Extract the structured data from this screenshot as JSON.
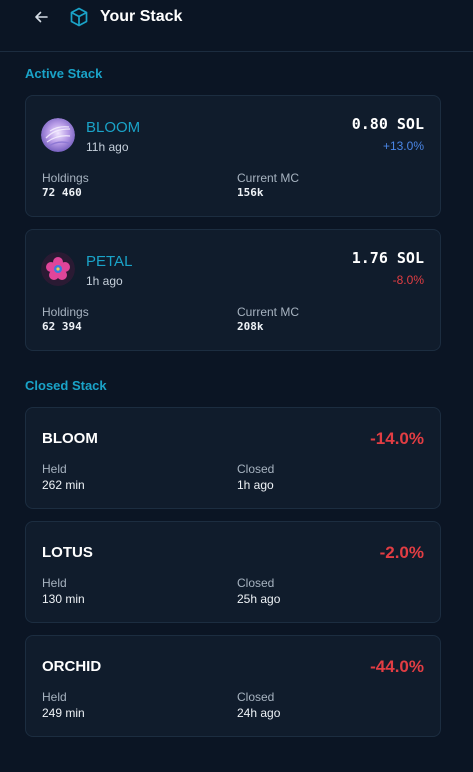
{
  "header": {
    "back_icon": "arrow-left-icon",
    "cube_icon": "cube-icon",
    "title": "Your Stack"
  },
  "active": {
    "title": "Active Stack",
    "labels": {
      "holdings": "Holdings",
      "mc": "Current MC"
    },
    "items": [
      {
        "name": "BLOOM",
        "age": "11h ago",
        "price": "0.80 SOL",
        "change": "+13.0%",
        "holdings": "72 460",
        "mc": "156k"
      },
      {
        "name": "PETAL",
        "age": "1h ago",
        "price": "1.76 SOL",
        "change": "-8.0%",
        "holdings": "62 394",
        "mc": "208k"
      }
    ]
  },
  "closed": {
    "title": "Closed Stack",
    "labels": {
      "held": "Held",
      "closed": "Closed"
    },
    "items": [
      {
        "name": "BLOOM",
        "change": "-14.0%",
        "held": "262 min",
        "closed": "1h ago"
      },
      {
        "name": "LOTUS",
        "change": "-2.0%",
        "held": "130 min",
        "closed": "25h ago"
      },
      {
        "name": "ORCHID",
        "change": "-44.0%",
        "held": "249 min",
        "closed": "24h ago"
      }
    ]
  },
  "colors": {
    "accent": "#1aa3c8",
    "positive": "#4a86e6",
    "negative": "#e23d43",
    "background": "#0b1524",
    "card": "#101c2c"
  }
}
